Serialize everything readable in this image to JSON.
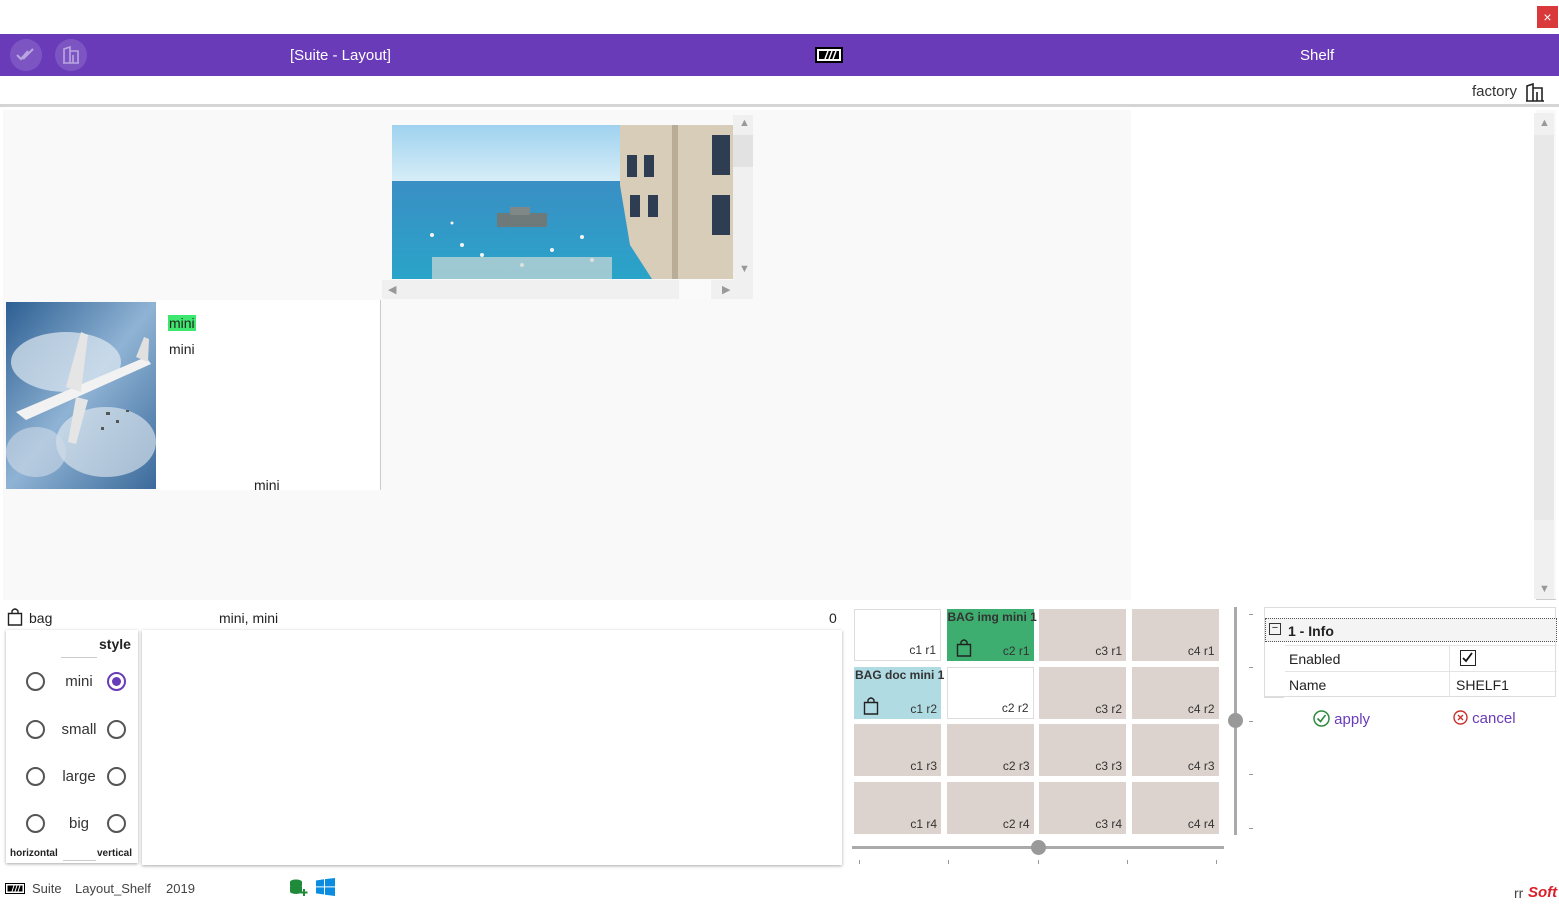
{
  "window": {
    "close_label": "×"
  },
  "topbar": {
    "title_left": "[Suite - Layout]",
    "title_right": "Shelf",
    "accent": "#6a3bb8",
    "icons": [
      "check-all-icon",
      "shelf-icon",
      "suite-logo-icon"
    ]
  },
  "subbar": {
    "factory_label": "factory"
  },
  "canvas": {
    "mini_highlight": "mini",
    "mini_line2": "mini",
    "mini_bottom": "mini",
    "images": [
      "harbor-photo",
      "airplane-photo"
    ]
  },
  "bag_row": {
    "label": "bag",
    "items": "mini, mini",
    "count": "0"
  },
  "style_panel": {
    "header": "style",
    "options": [
      "mini",
      "small",
      "large",
      "big"
    ],
    "selected": "mini",
    "footer_left": "horizontal",
    "footer_right": "vertical"
  },
  "grid": {
    "rows": [
      [
        {
          "label": "c1 r1",
          "kind": "empty"
        },
        {
          "label": "c2 r1",
          "kind": "bag-img",
          "title": "BAG img mini 1"
        },
        {
          "label": "c3 r1",
          "kind": "cell"
        },
        {
          "label": "c4 r1",
          "kind": "cell"
        }
      ],
      [
        {
          "label": "c1 r2",
          "kind": "bag-doc",
          "title": "BAG doc mini 1"
        },
        {
          "label": "c2 r2",
          "kind": "empty"
        },
        {
          "label": "c3 r2",
          "kind": "cell"
        },
        {
          "label": "c4 r2",
          "kind": "cell"
        }
      ],
      [
        {
          "label": "c1 r3",
          "kind": "cell"
        },
        {
          "label": "c2 r3",
          "kind": "cell"
        },
        {
          "label": "c3 r3",
          "kind": "cell"
        },
        {
          "label": "c4 r3",
          "kind": "cell"
        }
      ],
      [
        {
          "label": "c1 r4",
          "kind": "cell"
        },
        {
          "label": "c2 r4",
          "kind": "cell"
        },
        {
          "label": "c3 r4",
          "kind": "cell"
        },
        {
          "label": "c4 r4",
          "kind": "cell"
        }
      ]
    ],
    "colors": {
      "cell": "#ddd3ce",
      "empty": "#ffffff",
      "bag_img": "#3dae6f",
      "bag_doc": "#b1dbe3"
    }
  },
  "info": {
    "section": "1 - Info",
    "enabled_label": "Enabled",
    "enabled": true,
    "name_label": "Name",
    "name_value": "SHELF1",
    "apply": "apply",
    "cancel": "cancel"
  },
  "footer": {
    "suite": "Suite",
    "layout": "Layout_Shelf",
    "year": "2019",
    "brand_prefix": "rr",
    "brand": "Soft"
  }
}
